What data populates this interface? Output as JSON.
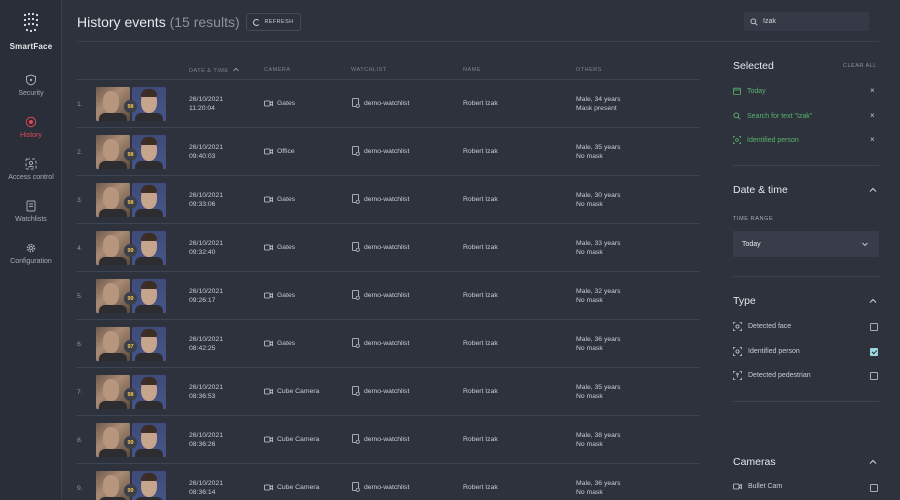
{
  "app": {
    "name": "SmartFace"
  },
  "nav": [
    {
      "label": "Security",
      "icon": "shield-icon",
      "active": false
    },
    {
      "label": "History",
      "icon": "history-icon",
      "active": true
    },
    {
      "label": "Access control",
      "icon": "access-control-icon",
      "active": false
    },
    {
      "label": "Watchlists",
      "icon": "watchlist-icon",
      "active": false
    },
    {
      "label": "Configuration",
      "icon": "gear-icon",
      "active": false
    }
  ],
  "header": {
    "title": "History events",
    "count": "(15 results)",
    "refresh_label": "REFRESH",
    "search_value": "Izak"
  },
  "table": {
    "columns": [
      "DATE & TIME",
      "CAMERA",
      "WATCHLIST",
      "NAME",
      "OTHERS"
    ],
    "rows": [
      {
        "index": "1.",
        "score": "98",
        "date": "26/10/2021",
        "time": "11:20:04",
        "camera": "Gates",
        "watchlist": "demo-watchlist",
        "name": "Robert Izak",
        "others1": "Male, 34 years",
        "others2": "Mask present"
      },
      {
        "index": "2.",
        "score": "98",
        "date": "26/10/2021",
        "time": "09:40:03",
        "camera": "Office",
        "watchlist": "demo-watchlist",
        "name": "Robert Izak",
        "others1": "Male, 35 years",
        "others2": "No mask"
      },
      {
        "index": "3.",
        "score": "98",
        "date": "26/10/2021",
        "time": "09:33:06",
        "camera": "Gates",
        "watchlist": "demo-watchlist",
        "name": "Robert Izak",
        "others1": "Male, 30 years",
        "others2": "No mask"
      },
      {
        "index": "4.",
        "score": "99",
        "date": "26/10/2021",
        "time": "09:32:40",
        "camera": "Gates",
        "watchlist": "demo-watchlist",
        "name": "Robert Izak",
        "others1": "Male, 33 years",
        "others2": "No mask"
      },
      {
        "index": "5.",
        "score": "99",
        "date": "26/10/2021",
        "time": "09:26:17",
        "camera": "Gates",
        "watchlist": "demo-watchlist",
        "name": "Robert Izak",
        "others1": "Male, 32 years",
        "others2": "No mask"
      },
      {
        "index": "6.",
        "score": "97",
        "date": "26/10/2021",
        "time": "08:42:25",
        "camera": "Gates",
        "watchlist": "demo-watchlist",
        "name": "Robert Izak",
        "others1": "Male, 36 years",
        "others2": "No mask"
      },
      {
        "index": "7.",
        "score": "98",
        "date": "26/10/2021",
        "time": "08:36:53",
        "camera": "Cube Camera",
        "watchlist": "demo-watchlist",
        "name": "Robert Izak",
        "others1": "Male, 35 years",
        "others2": "No mask"
      },
      {
        "index": "8.",
        "score": "99",
        "date": "26/10/2021",
        "time": "08:36:26",
        "camera": "Cube Camera",
        "watchlist": "demo-watchlist",
        "name": "Robert Izak",
        "others1": "Male, 38 years",
        "others2": "No mask"
      },
      {
        "index": "9.",
        "score": "99",
        "date": "26/10/2021",
        "time": "08:36:14",
        "camera": "Cube Camera",
        "watchlist": "demo-watchlist",
        "name": "Robert Izak",
        "others1": "Male, 36 years",
        "others2": "No mask"
      }
    ]
  },
  "selected": {
    "title": "Selected",
    "clear_all": "CLEAR ALL",
    "filters": [
      {
        "label": "Today",
        "icon": "calendar-icon"
      },
      {
        "label": "Search for text \"Izak\"",
        "icon": "search-icon"
      },
      {
        "label": "Identified person",
        "icon": "identified-person-icon"
      }
    ]
  },
  "date_time": {
    "title": "Date & time",
    "range_label": "TIME RANGE",
    "range_value": "Today"
  },
  "type": {
    "title": "Type",
    "items": [
      {
        "label": "Detected face",
        "checked": false
      },
      {
        "label": "Identified person",
        "checked": true
      },
      {
        "label": "Detected pedestrian",
        "checked": false
      }
    ]
  },
  "cameras": {
    "title": "Cameras",
    "items": [
      {
        "label": "Bullet Cam",
        "checked": false
      }
    ]
  },
  "colors": {
    "background": "#2e323d",
    "accent_active": "#e0485a",
    "filter_green": "#59b36c",
    "score_yellow": "#f1c64d",
    "checkbox_checked": "#9ad9df"
  }
}
